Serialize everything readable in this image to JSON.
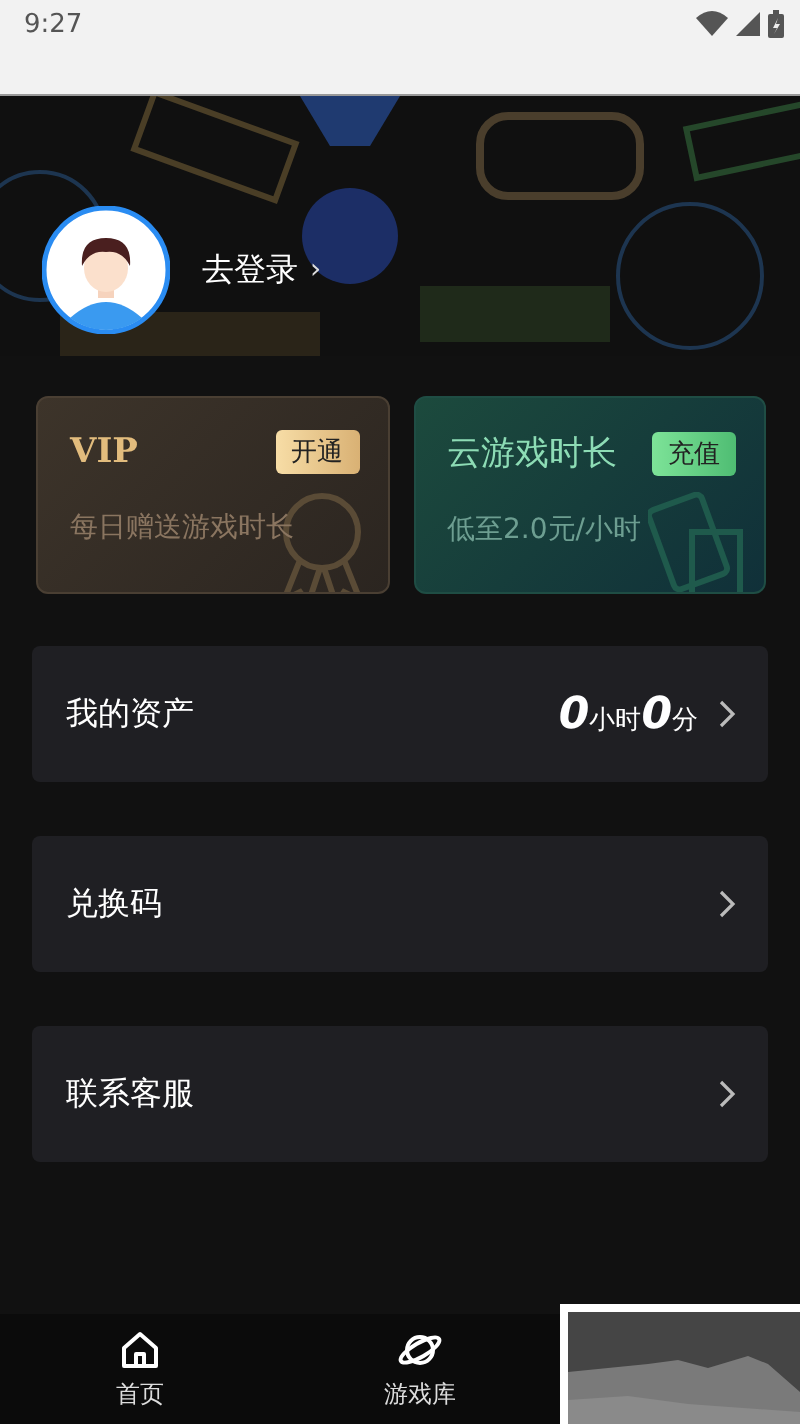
{
  "status_bar": {
    "time": "9:27"
  },
  "profile": {
    "login_label": "去登录",
    "chevron": "›"
  },
  "cards": [
    {
      "kind": "vip",
      "title": "VIP",
      "action": "开通",
      "subtitle": "每日赠送游戏时长"
    },
    {
      "kind": "cloud",
      "title": "云游戏时长",
      "action": "充值",
      "subtitle": "低至2.0元/小时"
    }
  ],
  "menu": [
    {
      "label": "我的资产",
      "value_parts": [
        {
          "kind": "big",
          "text": "0"
        },
        {
          "kind": "unit",
          "text": "小时"
        },
        {
          "kind": "big",
          "text": "0"
        },
        {
          "kind": "unit",
          "text": "分"
        }
      ]
    },
    {
      "label": "兑换码"
    },
    {
      "label": "联系客服"
    }
  ],
  "bottom_nav": [
    {
      "label": "首页",
      "kind": "home"
    },
    {
      "label": "游戏库",
      "kind": "library"
    }
  ]
}
